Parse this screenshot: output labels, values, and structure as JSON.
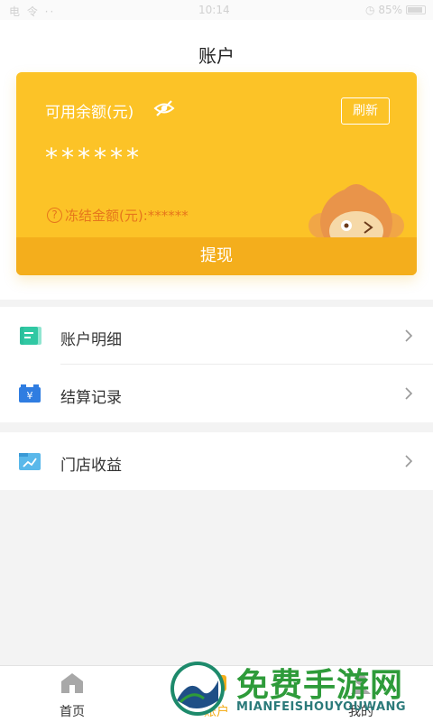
{
  "status_bar": {
    "left": "电 令 ··",
    "time": "10:14",
    "right": "◷ 85%"
  },
  "page": {
    "title": "账户"
  },
  "card": {
    "balance_label": "可用余额(元)",
    "refresh_label": "刷新",
    "balance_value": "******",
    "frozen_label": "冻结金额(元):******",
    "withdraw_label": "提现",
    "colors": {
      "card": "#fcc327",
      "withdraw": "#f4ae1c",
      "frozen_text": "#e6761c"
    }
  },
  "menu": {
    "group1": [
      {
        "label": "账户明细",
        "icon": "ledger-icon"
      },
      {
        "label": "结算记录",
        "icon": "yen-wallet-icon"
      }
    ],
    "group2": [
      {
        "label": "门店收益",
        "icon": "chart-folder-icon"
      }
    ]
  },
  "tabbar": {
    "tabs": [
      {
        "label": "首页",
        "icon": "home-icon"
      },
      {
        "label": "账户",
        "icon": "account-icon"
      },
      {
        "label": "我的",
        "icon": "profile-icon"
      }
    ]
  },
  "watermark": {
    "title": "免费手游网",
    "subtitle": "MIANFEISHOUYOUWANG"
  }
}
